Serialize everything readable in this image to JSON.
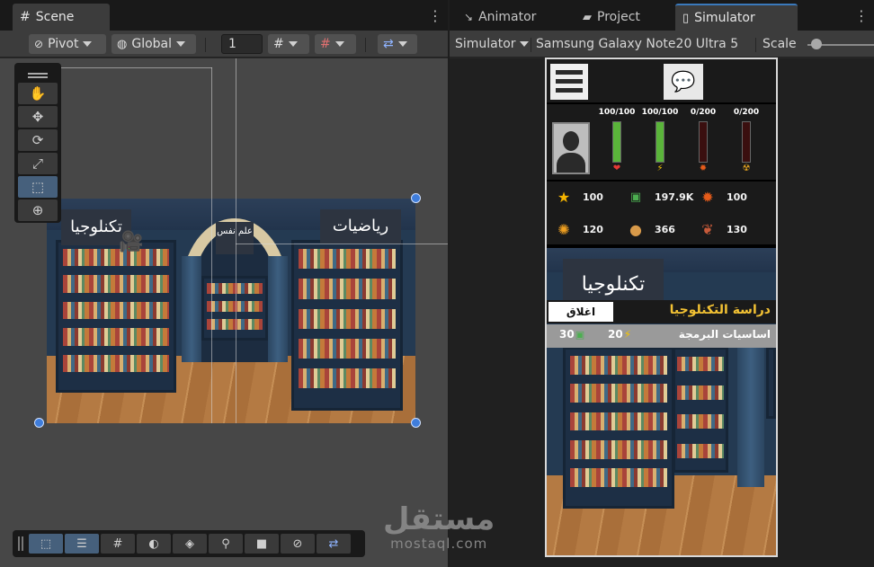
{
  "scene_panel": {
    "tab_label": "Scene",
    "toolbar": {
      "pivot": "Pivot",
      "global": "Global",
      "grid_value": "1"
    }
  },
  "right_panel": {
    "tabs": [
      {
        "label": "Animator"
      },
      {
        "label": "Project"
      },
      {
        "label": "Simulator"
      }
    ],
    "toolbar": {
      "simulator": "Simulator",
      "device": "Samsung Galaxy Note20 Ultra 5",
      "scale": "Scale",
      "scale_level": 0.05
    }
  },
  "scene_view": {
    "sign_left": "تكنلوجيا",
    "sign_center": "علم نفس",
    "sign_right": "رياضيات"
  },
  "game": {
    "meters": [
      {
        "label": "100/100",
        "fill": 1.0,
        "color": "#5ab43a",
        "icon": "heart-icon"
      },
      {
        "label": "100/100",
        "fill": 1.0,
        "color": "#5ab43a",
        "icon": "lightning-icon"
      },
      {
        "label": "0/200",
        "fill": 0.0,
        "color": "#c0392b",
        "icon": "fire-icon"
      },
      {
        "label": "0/200",
        "fill": 0.0,
        "color": "#c0392b",
        "icon": "hazard-icon"
      }
    ],
    "resources": [
      {
        "icon": "star-icon",
        "value": "100"
      },
      {
        "icon": "cash-icon",
        "value": "197.9K"
      },
      {
        "icon": "flame-icon",
        "value": "100"
      },
      {
        "icon": "bulb-icon",
        "value": "120"
      },
      {
        "icon": "bread-icon",
        "value": "366"
      },
      {
        "icon": "meat-icon",
        "value": "130"
      }
    ],
    "dialog": {
      "sign": "تكنلوجيا",
      "heading": "دراسة التكنلوجيا",
      "close_label": "اغلاق",
      "course_name": "اساسيات البرمجة",
      "energy_cost": "20",
      "money_cost": "30"
    }
  },
  "watermark": {
    "arabic": "مستقل",
    "latin": "mostaql.com"
  }
}
